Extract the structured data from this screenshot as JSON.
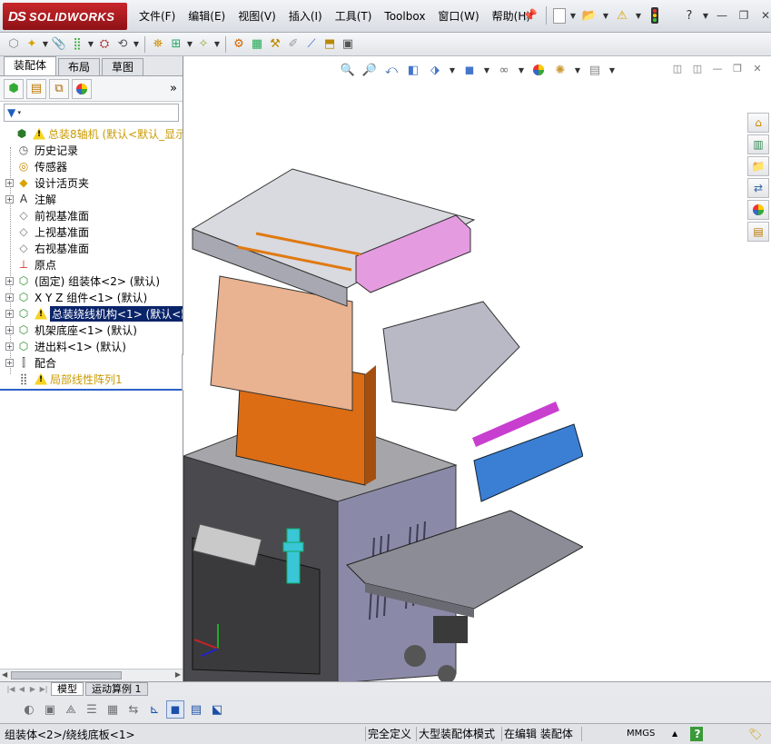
{
  "app": {
    "brand_ds": "DS",
    "brand_name": "SOLIDWORKS"
  },
  "menu": [
    "文件(F)",
    "编辑(E)",
    "视图(V)",
    "插入(I)",
    "工具(T)",
    "Toolbox",
    "窗口(W)",
    "帮助(H)"
  ],
  "panel": {
    "tabs": [
      "装配体",
      "布局",
      "草图"
    ],
    "more_label": "»"
  },
  "tree": [
    {
      "label": "总装8轴机   (默认<默认_显示",
      "icon": "assembly-icon",
      "warn": true,
      "yellow": true,
      "exp": "none",
      "indent": 0
    },
    {
      "label": "历史记录",
      "icon": "history-icon",
      "indent": 1
    },
    {
      "label": "传感器",
      "icon": "sensor-icon",
      "indent": 1
    },
    {
      "label": "设计活页夹",
      "icon": "binder-icon",
      "exp": "+",
      "indent": 1
    },
    {
      "label": "注解",
      "icon": "annotation-icon",
      "exp": "+",
      "indent": 1
    },
    {
      "label": "前视基准面",
      "icon": "plane-icon",
      "indent": 1
    },
    {
      "label": "上视基准面",
      "icon": "plane-icon",
      "indent": 1
    },
    {
      "label": "右视基准面",
      "icon": "plane-icon",
      "indent": 1
    },
    {
      "label": "原点",
      "icon": "origin-icon",
      "indent": 1
    },
    {
      "label": "(固定) 组装体<2> (默认)",
      "icon": "subassembly-icon",
      "exp": "+",
      "indent": 1
    },
    {
      "label": "X Y Z 组件<1> (默认)",
      "icon": "subassembly-icon",
      "exp": "+",
      "indent": 1
    },
    {
      "label": "总装绕线机构<1> (默认<默",
      "icon": "subassembly-icon",
      "exp": "+",
      "warn": true,
      "selected": true,
      "indent": 1
    },
    {
      "label": "机架底座<1> (默认)",
      "icon": "subassembly-icon",
      "exp": "+",
      "indent": 1
    },
    {
      "label": "进出料<1> (默认)",
      "icon": "subassembly-icon",
      "exp": "+",
      "indent": 1
    },
    {
      "label": "配合",
      "icon": "mates-icon",
      "exp": "+",
      "indent": 1
    },
    {
      "label": "局部线性阵列1",
      "icon": "pattern-icon",
      "warn": true,
      "yellow": true,
      "indent": 1
    }
  ],
  "bottom_tabs": [
    "模型",
    "运动算例 1"
  ],
  "status": {
    "left": "组装体<2>/绕线底板<1>",
    "cells": [
      "完全定义",
      "大型装配体模式",
      "在编辑 装配体",
      "MMGS",
      "▲",
      "?"
    ]
  }
}
